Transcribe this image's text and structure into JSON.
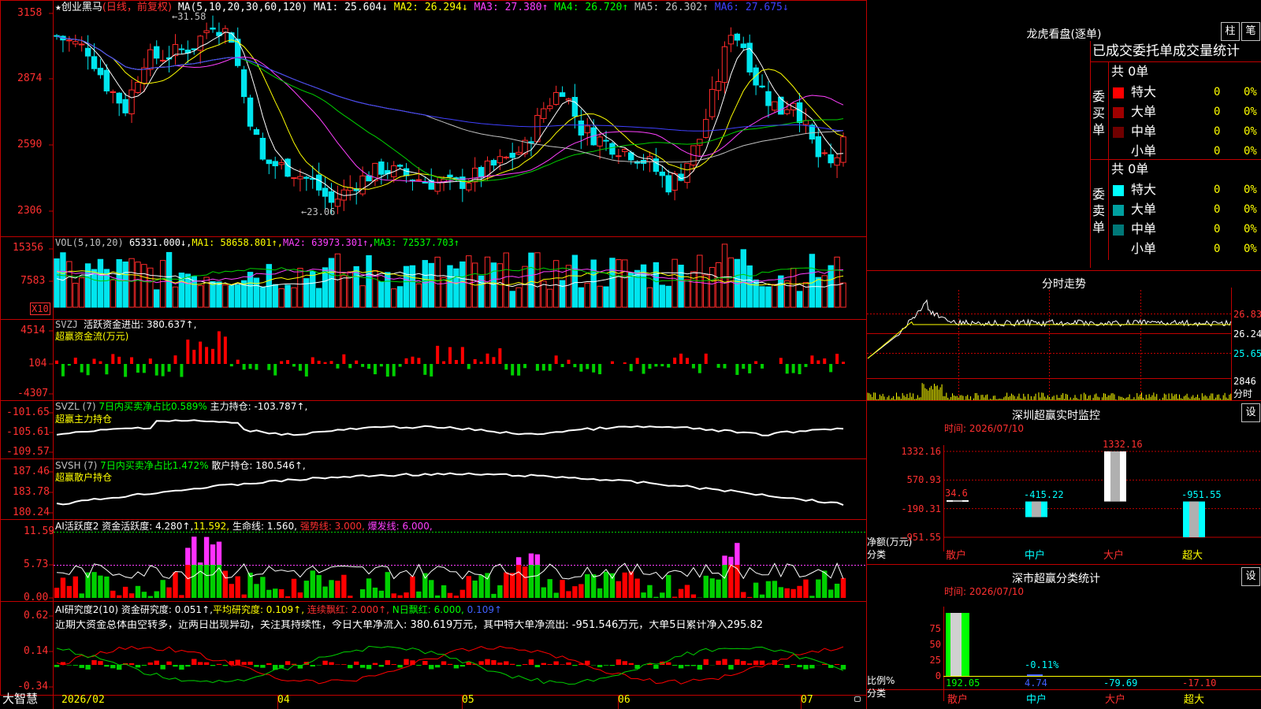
{
  "colors": {
    "up": "#ff2a2a",
    "down": "#00e5ee",
    "green": "#00d000",
    "yellow": "#ffff00",
    "magenta": "#ff40ff",
    "blue": "#4040ff",
    "white": "#ffffff",
    "grey": "#c0c0c0",
    "frame": "#c00000"
  },
  "main": {
    "star": "★",
    "name": "创业黑马",
    "period": "(日线，前复权)",
    "ma_params": "MA(5,10,20,30,60,120)",
    "ma1": "MA1: 25.604↓",
    "ma2": "MA2: 26.294↓",
    "ma3": "MA3: 27.380↑",
    "ma4": "MA4: 26.720↑",
    "ma5": "MA5: 26.302↑",
    "ma6": "MA6: 27.675↓",
    "y_ticks": [
      "3158",
      "2874",
      "2590",
      "2306"
    ],
    "high_label": "31.58",
    "low_label": "←23.06",
    "high_arrow": "←"
  },
  "vol": {
    "params": "VOL(5,10,20)",
    "value": "65331.000↓,",
    "ma1": "MA1: 58658.801↑,",
    "ma2": "MA2: 63973.301↑,",
    "ma3": "MA3: 72537.703↑",
    "y_ticks": [
      "15356",
      "7583"
    ],
    "unit": "X10"
  },
  "svzj": {
    "name": "SVZJ",
    "label": "活跃资金进出: 380.637↑,",
    "title2": "超赢资金流(万元)",
    "y_ticks": [
      "4514",
      "104",
      "-4307"
    ]
  },
  "svzl": {
    "name": "SVZL (7)",
    "ratio": "7日内买卖净占比0.589%",
    "hold": "主力持仓: -103.787↑,",
    "title2": "超赢主力持仓",
    "y_ticks": [
      "-101.65",
      "-105.61",
      "-109.57"
    ]
  },
  "svsh": {
    "name": "SVSH (7)",
    "ratio": "7日内买卖净占比1.472%",
    "hold": "散户持仓: 180.546↑,",
    "title2": "超赢散户持仓",
    "y_ticks": [
      "187.46",
      "183.78",
      "180.24"
    ]
  },
  "ai1": {
    "name": "AI活跃度2",
    "a": "资金活跃度: 4.280↑,",
    "b": "11.592,",
    "c": "生命线: 1.560,",
    "d": "强势线: 3.000,",
    "e": "爆发线: 6.000,",
    "y_ticks": [
      "11.59",
      "5.73",
      "0.00"
    ]
  },
  "ai2": {
    "name": "AI研究度2(10)",
    "a": "资金研究度: 0.051↑,",
    "b": "平均研究度: 0.109↑,",
    "c": "连续飘红: 2.000↑,",
    "d": "N日飘红: 6.000,",
    "e": "0.109↑",
    "comment": "近期大资金总体由空转多，近两日出现异动，关注其持续性，今日大单净流入: 380.619万元，其中特大单净流出: -951.546万元，大单5日累计净入295.82",
    "y_ticks": [
      "0.62",
      "0.14",
      "-0.34"
    ]
  },
  "xaxis": {
    "app": "大智慧",
    "labels": [
      "2026/02",
      "04",
      "05",
      "06",
      "07"
    ]
  },
  "lhb": {
    "title": "龙虎看盘(逐单)",
    "btn1": "柱",
    "btn2": "笔",
    "header": "已成交委托单成交量统计",
    "buy": {
      "side": "委买单",
      "total": "共 0单",
      "rows": [
        {
          "label": "特大",
          "v": "0",
          "p": "0%",
          "c": "#ff0000"
        },
        {
          "label": "大单",
          "v": "0",
          "p": "0%",
          "c": "#a00000"
        },
        {
          "label": "中单",
          "v": "0",
          "p": "0%",
          "c": "#700000"
        },
        {
          "label": "小单",
          "v": "0",
          "p": "0%",
          "c": ""
        }
      ]
    },
    "sell": {
      "side": "委卖单",
      "total": "共 0单",
      "rows": [
        {
          "label": "特大",
          "v": "0",
          "p": "0%",
          "c": "#00ffff"
        },
        {
          "label": "大单",
          "v": "0",
          "p": "0%",
          "c": "#00a0a0"
        },
        {
          "label": "中单",
          "v": "0",
          "p": "0%",
          "c": "#007878"
        },
        {
          "label": "小单",
          "v": "0",
          "p": "0%",
          "c": ""
        }
      ]
    }
  },
  "intraday": {
    "title": "分时走势",
    "y_ticks": [
      "26.83",
      "26.24",
      "25.65"
    ],
    "vol": "2846",
    "unit": "分时"
  },
  "monitor": {
    "title": "深圳超赢实时监控",
    "btn": "设",
    "date": "时间: 2026/07/10",
    "y_ticks": [
      "1332.16",
      "570.93",
      "-190.31",
      "-951.55"
    ],
    "ylabel1": "净额(万元)",
    "ylabel2": "分类",
    "bars": [
      {
        "label": "散户",
        "value": 34.6,
        "text": "34.6"
      },
      {
        "label": "中户",
        "value": -415.22,
        "text": "-415.22"
      },
      {
        "label": "大户",
        "value": 1332.16,
        "text": "1332.16"
      },
      {
        "label": "超大",
        "value": -951.55,
        "text": "-951.55"
      }
    ]
  },
  "classify": {
    "title": "深市超赢分类统计",
    "btn": "设",
    "date": "时间: 2026/07/10",
    "y_ticks": [
      "75",
      "50",
      "25",
      "0"
    ],
    "ylabel1": "比例%",
    "ylabel2": "分类",
    "pct_label": "-0.11%",
    "bars": [
      {
        "label": "散户",
        "value": "192.05",
        "c": "#00ff00"
      },
      {
        "label": "中户",
        "value": "4.74",
        "c": "#4060ff"
      },
      {
        "label": "大户",
        "value": "-79.69",
        "c": "#00ffff"
      },
      {
        "label": "超大",
        "value": "-17.10",
        "c": "#ff3030"
      }
    ]
  }
}
